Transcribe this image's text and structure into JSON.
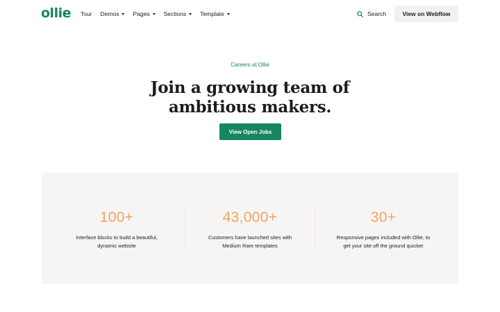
{
  "header": {
    "logo": "ollie",
    "nav": [
      {
        "label": "Tour",
        "has_caret": false
      },
      {
        "label": "Demos",
        "has_caret": true
      },
      {
        "label": "Pages",
        "has_caret": true
      },
      {
        "label": "Sections",
        "has_caret": true
      },
      {
        "label": "Template",
        "has_caret": true
      }
    ],
    "search_label": "Search",
    "webflow_button": "View on Webflow"
  },
  "hero": {
    "eyebrow": "Careers at Ollie",
    "title_line1": "Join a growing team of",
    "title_line2": "ambitious makers.",
    "cta_label": "View Open Jobs"
  },
  "stats": [
    {
      "value": "100+",
      "line1": "Interface blocks to build a beautiful,",
      "line2": "dynamic website"
    },
    {
      "value": "43,000+",
      "line1": "Customers have launched sites with",
      "line2": "Medium Rare templates"
    },
    {
      "value": "30+",
      "line1": "Responsive pages included with Ollie, to",
      "line2": "get your site off the ground quicker"
    }
  ],
  "colors": {
    "brand_green": "#168562",
    "stat_orange": "#f2a263",
    "stats_bg": "#f7f5f3",
    "button_gray": "#f1f1f1"
  },
  "icons": {
    "search": "search-icon",
    "caret": "caret-down-icon"
  }
}
